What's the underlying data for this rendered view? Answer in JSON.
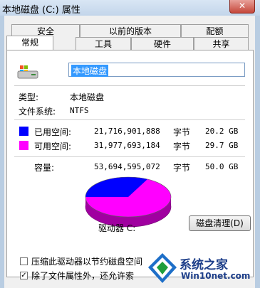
{
  "window": {
    "title": "本地磁盘 (C:) 属性",
    "close_icon": "close-icon"
  },
  "tabs_row1": [
    "安全",
    "以前的版本",
    "配额"
  ],
  "tabs_row2": [
    "常规",
    "工具",
    "硬件",
    "共享"
  ],
  "general": {
    "volume_name": "本地磁盘",
    "type_label": "类型:",
    "type_value": "本地磁盘",
    "fs_label": "文件系统:",
    "fs_value": "NTFS",
    "used": {
      "label": "已用空间:",
      "bytes": "21,716,901,888",
      "unit": "字节",
      "size": "20.2 GB",
      "color": "#0000ff"
    },
    "free": {
      "label": "可用空间:",
      "bytes": "31,977,693,184",
      "unit": "字节",
      "size": "29.7 GB",
      "color": "#ff00ff"
    },
    "capacity": {
      "label": "容量:",
      "bytes": "53,694,595,072",
      "unit": "字节",
      "size": "50.0 GB"
    },
    "drive_label": "驱动器 C:",
    "cleanup_button": "磁盘清理(D)",
    "compress_option": "压缩此驱动器以节约磁盘空间",
    "index_option": "除了文件属性外，还允许索",
    "compress_checked": false,
    "index_checked": true
  },
  "watermark": {
    "brand": "系统之家",
    "site": "Win10net.com"
  }
}
